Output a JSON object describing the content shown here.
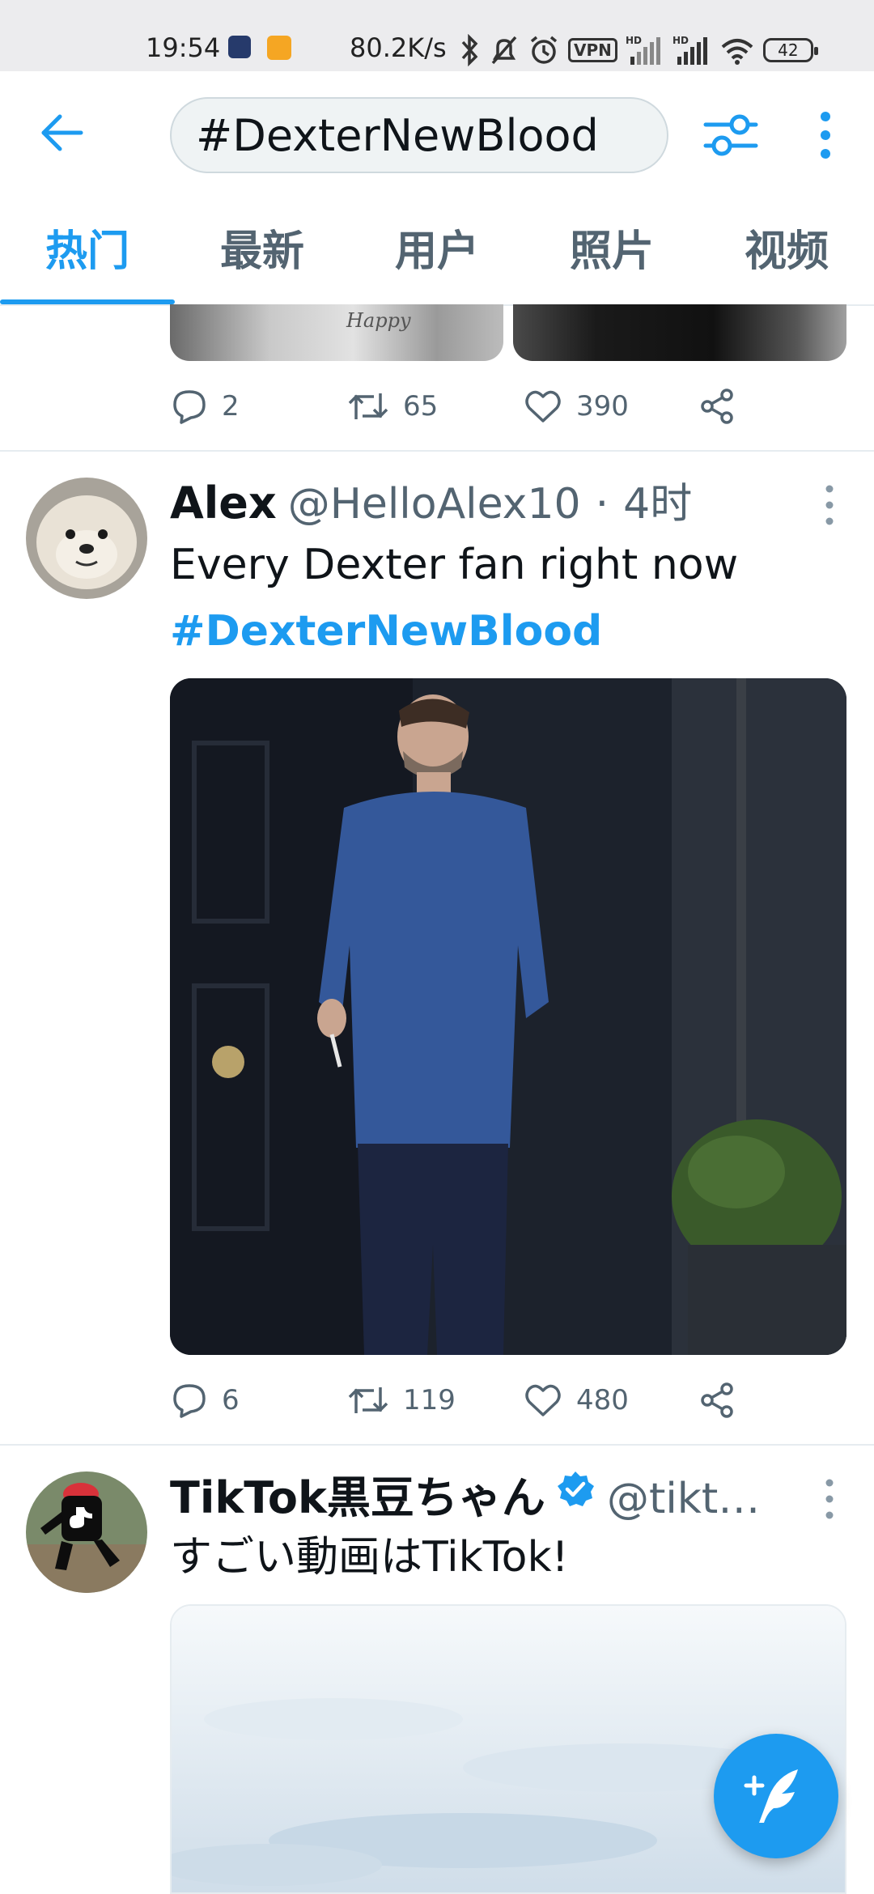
{
  "status_bar": {
    "time": "19:54",
    "network_speed": "80.2K/s",
    "vpn_label": "VPN",
    "hd_label": "HD",
    "battery": "42"
  },
  "search": {
    "query": "#DexterNewBlood"
  },
  "tabs": [
    {
      "label": "热门",
      "active": true
    },
    {
      "label": "最新",
      "active": false
    },
    {
      "label": "用户",
      "active": false
    },
    {
      "label": "照片",
      "active": false
    },
    {
      "label": "视频",
      "active": false
    }
  ],
  "prev_tweet": {
    "image_caption": "Happy",
    "replies": "2",
    "retweets": "65",
    "likes": "390"
  },
  "tweets": [
    {
      "name": "Alex",
      "handle": "@HelloAlex10",
      "separator": "·",
      "time": "4时",
      "text": "Every Dexter fan right now",
      "hashtag": "#DexterNewBlood",
      "replies": "6",
      "retweets": "119",
      "likes": "480"
    },
    {
      "name": "TikTok黒豆ちゃん",
      "handle": "@tikt…",
      "text": "すごい動画はTikTok!"
    }
  ],
  "colors": {
    "accent": "#1d9bf0",
    "secondary_text": "#536471",
    "primary_text": "#0f1419"
  }
}
